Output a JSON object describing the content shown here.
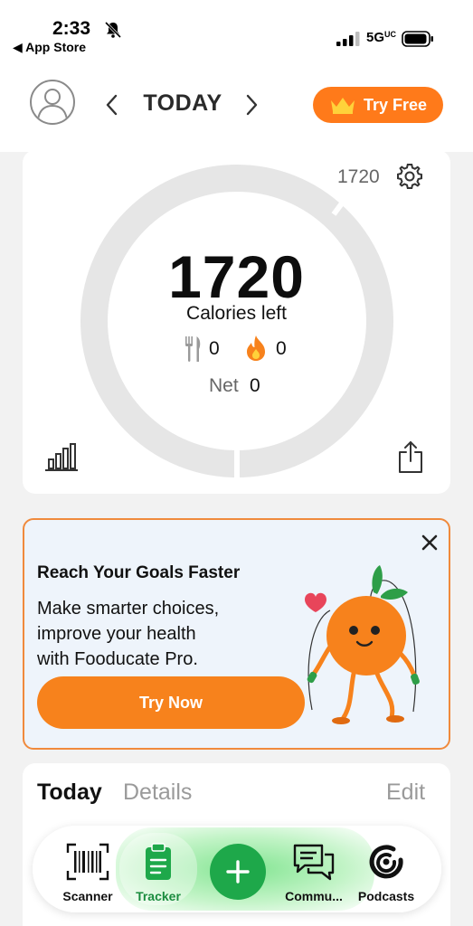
{
  "status_bar": {
    "time": "2:33",
    "back_label": "◀ App Store",
    "network": "5G",
    "network_badge": "UC"
  },
  "header": {
    "date_title": "TODAY",
    "try_free_label": "Try Free"
  },
  "calorie_card": {
    "goal": "1720",
    "calories_left": "1720",
    "calories_left_label": "Calories left",
    "food_calories": "0",
    "exercise_calories": "0",
    "net_label": "Net",
    "net_value": "0",
    "progress_consumed_fraction": 0
  },
  "promo": {
    "title": "Reach Your Goals Faster",
    "body_line1": "Make smarter choices,",
    "body_line2": "improve your health",
    "body_line3": "with Fooducate Pro.",
    "button_label": "Try Now"
  },
  "summary": {
    "today_tab": "Today",
    "details_tab": "Details",
    "edit_label": "Edit"
  },
  "tabbar": {
    "tabs": [
      {
        "label": "Scanner",
        "icon": "barcode-icon"
      },
      {
        "label": "Tracker",
        "icon": "clipboard-icon",
        "active": true
      },
      {
        "label": "Commu...",
        "icon": "chat-icon"
      },
      {
        "label": "Podcasts",
        "icon": "podcast-icon"
      }
    ],
    "add_icon": "plus-icon"
  },
  "colors": {
    "accent_orange": "#ff7a1a",
    "active_green": "#1ea84a",
    "ring_gray": "#e6e6e6",
    "promo_bg": "#eef4fb"
  }
}
